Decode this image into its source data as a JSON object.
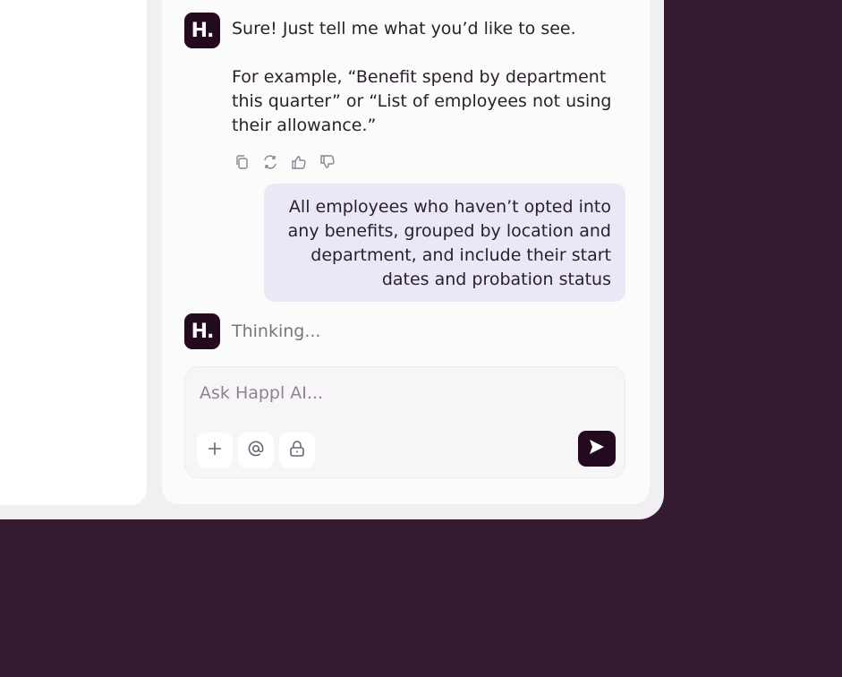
{
  "assistant": {
    "avatar_label": "H.",
    "reply_line1": "Sure! Just tell me what you’d like to see.",
    "reply_line2": "For example, “Benefit spend by department this quarter” or “List of employees not using their allowance.”",
    "thinking_text": "Thinking..."
  },
  "message_actions": [
    "copy-icon",
    "regenerate-icon",
    "thumbs-up-icon",
    "thumbs-down-icon"
  ],
  "user_message": "All employees who haven’t opted into any benefits, grouped by location and department, and include their start dates and probation status",
  "composer": {
    "placeholder": "Ask Happl AI...",
    "tools": [
      "plus-icon",
      "mention-icon",
      "lock-icon"
    ],
    "send_icon": "send-icon"
  },
  "colors": {
    "background": "#341b32",
    "brand": "#230a1f",
    "user_bubble": "#eae8f6"
  }
}
